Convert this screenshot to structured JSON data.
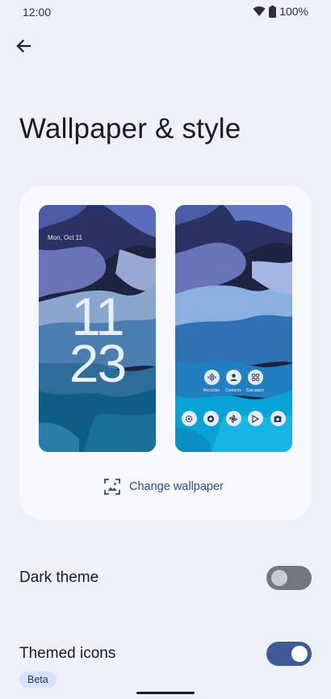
{
  "status_bar": {
    "time": "12:00",
    "battery": "100%",
    "icons": [
      "wifi-icon",
      "battery-icon"
    ]
  },
  "header": {
    "back_icon": "arrow-left-icon",
    "title": "Wallpaper & style"
  },
  "preview": {
    "lock_screen": {
      "date": "Mon, Oct 11",
      "clock_hour": "11",
      "clock_minute": "23"
    },
    "home_screen": {
      "top_apps": [
        {
          "label": "Recorder",
          "icon": "waveform-icon"
        },
        {
          "label": "Contacts",
          "icon": "person-icon"
        },
        {
          "label": "Calculator",
          "icon": "calculator-icon"
        }
      ],
      "dock_icons": [
        "settings-icon",
        "chrome-icon",
        "pinwheel-icon",
        "play-store-icon",
        "camera-icon"
      ]
    },
    "change_wallpaper_label": "Change wallpaper",
    "change_wallpaper_icon": "image-frame-icon"
  },
  "settings": {
    "dark_theme": {
      "label": "Dark theme",
      "enabled": false
    },
    "themed_icons": {
      "label": "Themed icons",
      "enabled": true,
      "badge": "Beta"
    }
  },
  "colors": {
    "background": "#edf0f8",
    "card": "#f6f8fe",
    "accent": "#3f5a96",
    "link": "#2d4a8a"
  }
}
